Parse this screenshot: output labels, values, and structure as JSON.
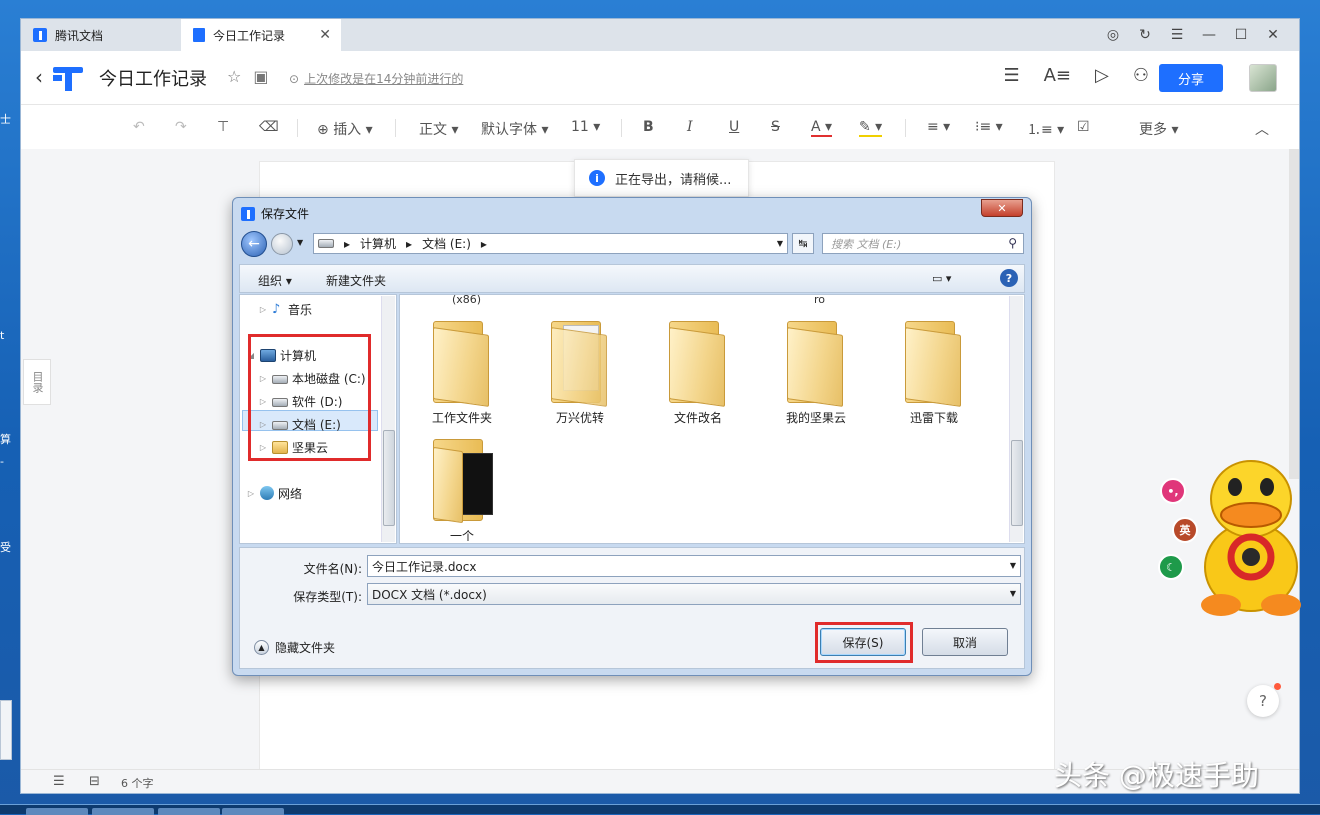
{
  "desktop": {
    "side_labels": [
      "士",
      "t",
      "算",
      "-",
      "受"
    ],
    "watermark": "头条 @极速手助"
  },
  "browser": {
    "tabs": [
      {
        "label": "腾讯文档",
        "active": false
      },
      {
        "label": "今日工作记录",
        "active": true
      }
    ]
  },
  "header": {
    "doc_title": "今日工作记录",
    "last_saved": "上次修改是在14分钟前进行的",
    "share_label": "分享"
  },
  "toolbar": {
    "insert": "插入",
    "style": "正文",
    "font": "默认字体",
    "size": "11",
    "more": "更多"
  },
  "toc_label": "目录",
  "toast": {
    "text": "正在导出，请稍候..."
  },
  "status": {
    "word_count": "6 个字"
  },
  "dialog": {
    "title": "保存文件",
    "breadcrumb": [
      "计算机",
      "文档 (E:)"
    ],
    "search_placeholder": "搜索 文档 (E:)",
    "commands": {
      "organize": "组织",
      "new_folder": "新建文件夹"
    },
    "tree": [
      {
        "label": "音乐",
        "icon": "music-icon",
        "level": 1
      },
      {
        "label": "计算机",
        "icon": "computer-icon",
        "level": 0
      },
      {
        "label": "本地磁盘 (C:)",
        "icon": "drive-icon",
        "level": 1
      },
      {
        "label": "软件 (D:)",
        "icon": "drive-icon",
        "level": 1
      },
      {
        "label": "文档 (E:)",
        "icon": "drive-icon",
        "level": 1,
        "selected": true
      },
      {
        "label": "坚果云",
        "icon": "folder-icon",
        "level": 1
      },
      {
        "label": "网络",
        "icon": "network-icon",
        "level": 0
      }
    ],
    "clipped_labels": [
      "(x86)",
      "ro"
    ],
    "files": [
      {
        "name": "工作文件夹"
      },
      {
        "name": "万兴优转"
      },
      {
        "name": "文件改名"
      },
      {
        "name": "我的坚果云"
      },
      {
        "name": "迅雷下载"
      },
      {
        "name": "一个"
      }
    ],
    "filename_label": "文件名(N):",
    "filename_value": "今日工作记录.docx",
    "filetype_label": "保存类型(T):",
    "filetype_value": "DOCX 文档 (*.docx)",
    "hide_folders": "隐藏文件夹",
    "save_button": "保存(S)",
    "cancel_button": "取消"
  },
  "assistant": {
    "badge_en": "英"
  }
}
